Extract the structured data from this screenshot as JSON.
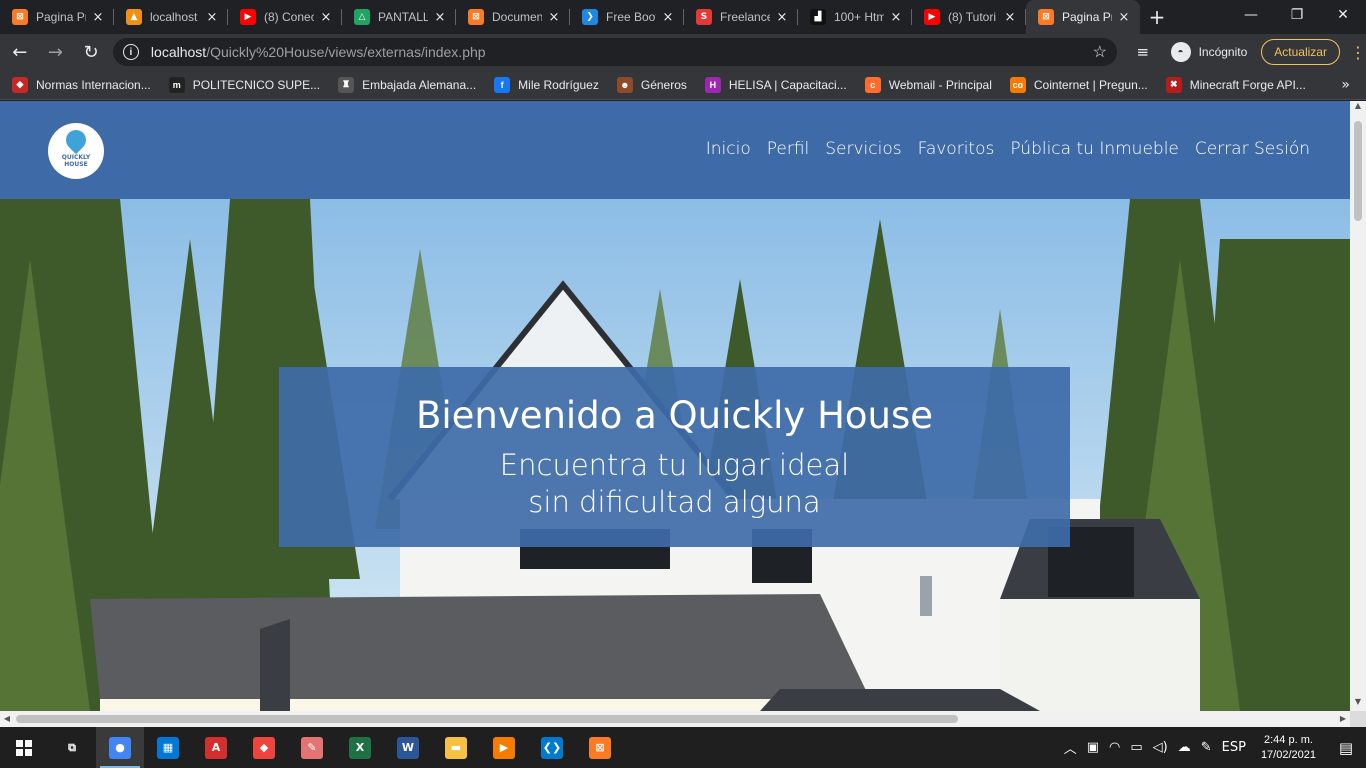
{
  "browser": {
    "tabs": [
      {
        "title": "Pagina Pr",
        "icon": "xampp-icon",
        "color": "#fb7a24",
        "glyph": "⊠"
      },
      {
        "title": "localhost",
        "icon": "phpmyadmin-icon",
        "color": "#f29111",
        "glyph": "▲"
      },
      {
        "title": "(8) Conec",
        "icon": "youtube-icon",
        "color": "#ff0000",
        "glyph": "▶"
      },
      {
        "title": "PANTALL",
        "icon": "drive-icon",
        "color": "#1fa463",
        "glyph": "△"
      },
      {
        "title": "Documen",
        "icon": "xampp-icon",
        "color": "#fb7a24",
        "glyph": "⊠"
      },
      {
        "title": "Free Boot",
        "icon": "bootstrap-icon",
        "color": "#1e88e5",
        "glyph": "❯"
      },
      {
        "title": "Freelance",
        "icon": "freelancer-s-icon",
        "color": "#e53935",
        "glyph": "S"
      },
      {
        "title": "100+ Htm",
        "icon": "html-icon",
        "color": "#111111",
        "glyph": "▟"
      },
      {
        "title": "(8) Tutori",
        "icon": "youtube-icon",
        "color": "#ff0000",
        "glyph": "▶"
      },
      {
        "title": "Pagina Pr",
        "icon": "xampp-icon",
        "color": "#fb7a24",
        "glyph": "⊠",
        "active": true
      }
    ],
    "new_tab": "+",
    "window_controls": {
      "minimize": "—",
      "restore": "❐",
      "close": "✕"
    },
    "nav": {
      "back": "←",
      "forward": "→",
      "reload": "↻"
    },
    "url": {
      "host": "localhost",
      "path": "/Quickly%20House/views/externas/index.php"
    },
    "incognito_label": "Incógnito",
    "update_label": "Actualizar",
    "bookmarks": [
      {
        "label": "Normas Internacion...",
        "icon": "puzzle-icon",
        "color": "#c62828",
        "glyph": "◆"
      },
      {
        "label": "POLITECNICO SUPE...",
        "icon": "m-logo-icon",
        "color": "#222222",
        "glyph": "m"
      },
      {
        "label": "Embajada Alemana...",
        "icon": "shield-icon",
        "color": "#555555",
        "glyph": "♜"
      },
      {
        "label": "Mile Rodríguez",
        "icon": "facebook-icon",
        "color": "#1877f2",
        "glyph": "f"
      },
      {
        "label": "Géneros",
        "icon": "avatar-icon",
        "color": "#8d4b2c",
        "glyph": "☻"
      },
      {
        "label": "HELISA | Capacitaci...",
        "icon": "helisa-icon",
        "color": "#9c27b0",
        "glyph": "H"
      },
      {
        "label": "Webmail - Principal",
        "icon": "cpanel-icon",
        "color": "#ff6c2c",
        "glyph": "c"
      },
      {
        "label": "Cointernet | Pregun...",
        "icon": "co-icon",
        "color": "#f57c00",
        "glyph": "co"
      },
      {
        "label": "Minecraft Forge API...",
        "icon": "forge-icon",
        "color": "#b71c1c",
        "glyph": "✖"
      }
    ],
    "bookmarks_more": "»"
  },
  "site": {
    "logo_text": [
      "QUICKLY",
      "HOUSE"
    ],
    "nav": [
      "Inicio",
      "Perfil",
      "Servicios",
      "Favoritos",
      "Pública tu Inmueble",
      "Cerrar Sesión"
    ],
    "hero_title": "Bienvenido a Quickly House",
    "hero_subtitle_1": "Encuentra tu lugar ideal",
    "hero_subtitle_2": "sin dificultad alguna",
    "colors": {
      "brand": "#3e6ba8"
    }
  },
  "taskbar": {
    "apps": [
      {
        "name": "task-view-icon",
        "color": "#1f1f1f",
        "glyph": "⧉"
      },
      {
        "name": "chrome-icon",
        "color": "#4285f4",
        "glyph": "●",
        "active": true
      },
      {
        "name": "store-icon",
        "color": "#0078d7",
        "glyph": "▦"
      },
      {
        "name": "acrobat-icon",
        "color": "#d32f2f",
        "glyph": "A"
      },
      {
        "name": "anydesk-icon",
        "color": "#ef443b",
        "glyph": "◆"
      },
      {
        "name": "paint-icon",
        "color": "#e57373",
        "glyph": "✎"
      },
      {
        "name": "excel-icon",
        "color": "#1e7145",
        "glyph": "X"
      },
      {
        "name": "word-icon",
        "color": "#2b579a",
        "glyph": "W"
      },
      {
        "name": "explorer-icon",
        "color": "#f6c244",
        "glyph": "▬"
      },
      {
        "name": "media-player-icon",
        "color": "#f57c00",
        "glyph": "▶"
      },
      {
        "name": "vscode-icon",
        "color": "#007acc",
        "glyph": "❮❯"
      },
      {
        "name": "xampp-icon",
        "color": "#fb7a24",
        "glyph": "⊠"
      }
    ],
    "language": "ESP",
    "time": "2:44 p. m.",
    "date": "17/02/2021"
  }
}
